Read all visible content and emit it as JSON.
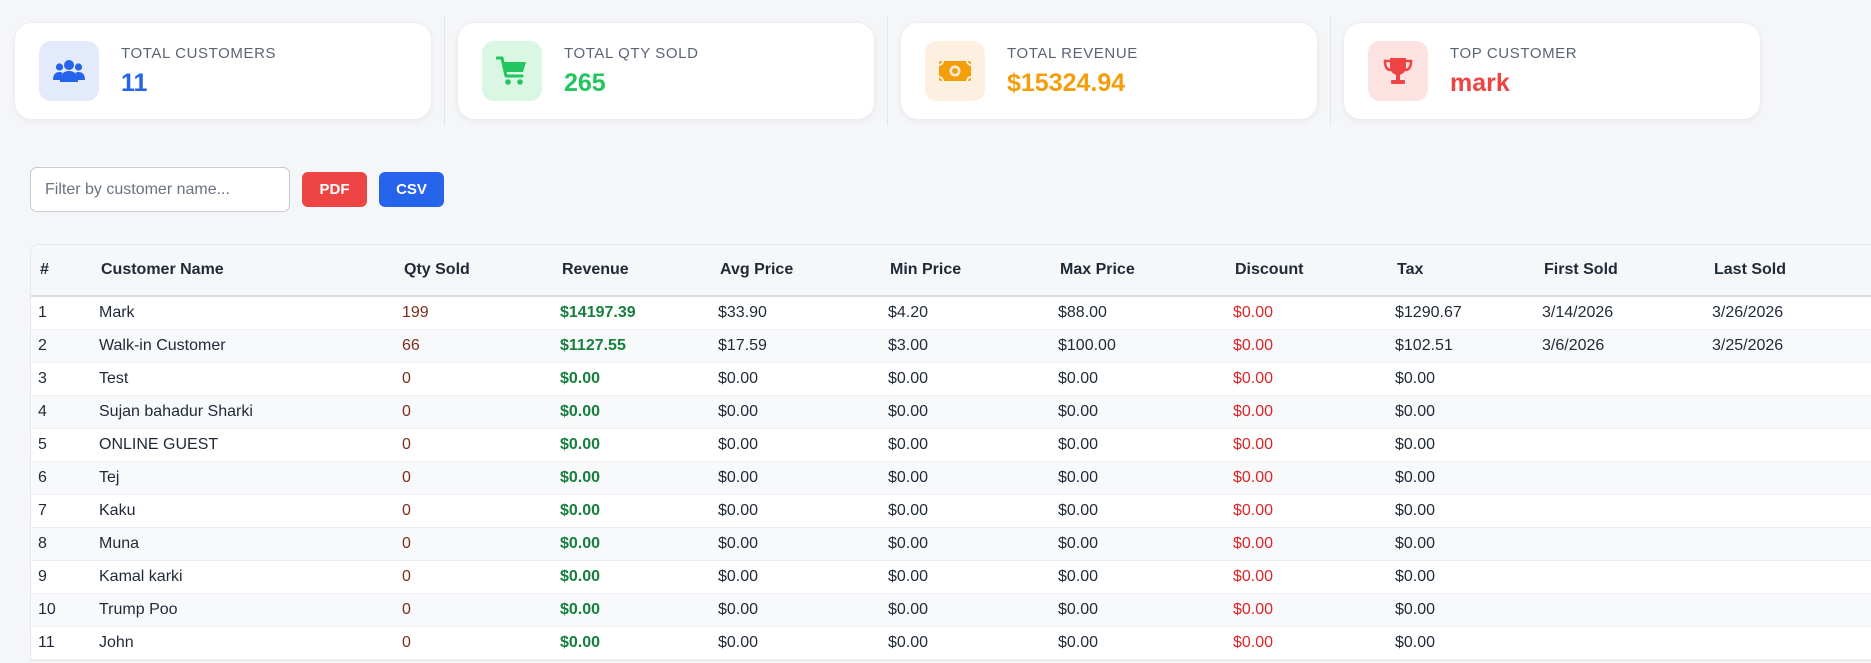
{
  "colors": {
    "blue": "#2563eb",
    "green": "#22c55e",
    "orange": "#f59e0b",
    "red": "#ef4444"
  },
  "cards": [
    {
      "label": "TOTAL CUSTOMERS",
      "value": "11",
      "icon": "users-icon"
    },
    {
      "label": "TOTAL QTY SOLD",
      "value": "265",
      "icon": "shopping-cart-icon"
    },
    {
      "label": "TOTAL REVENUE",
      "value": "$15324.94",
      "icon": "money-bill-icon"
    },
    {
      "label": "TOP CUSTOMER",
      "value": "mark",
      "icon": "trophy-icon"
    }
  ],
  "toolbar": {
    "filter_placeholder": "Filter by customer name...",
    "pdf_label": "PDF",
    "csv_label": "CSV"
  },
  "table": {
    "columns": [
      "#",
      "Customer Name",
      "Qty Sold",
      "Revenue",
      "Avg Price",
      "Min Price",
      "Max Price",
      "Discount",
      "Tax",
      "First Sold",
      "Last Sold"
    ],
    "rows": [
      [
        "1",
        "Mark",
        "199",
        "$14197.39",
        "$33.90",
        "$4.20",
        "$88.00",
        "$0.00",
        "$1290.67",
        "3/14/2026",
        "3/26/2026"
      ],
      [
        "2",
        "Walk-in Customer",
        "66",
        "$1127.55",
        "$17.59",
        "$3.00",
        "$100.00",
        "$0.00",
        "$102.51",
        "3/6/2026",
        "3/25/2026"
      ],
      [
        "3",
        "Test",
        "0",
        "$0.00",
        "$0.00",
        "$0.00",
        "$0.00",
        "$0.00",
        "$0.00",
        "",
        ""
      ],
      [
        "4",
        "Sujan bahadur Sharki",
        "0",
        "$0.00",
        "$0.00",
        "$0.00",
        "$0.00",
        "$0.00",
        "$0.00",
        "",
        ""
      ],
      [
        "5",
        "ONLINE GUEST",
        "0",
        "$0.00",
        "$0.00",
        "$0.00",
        "$0.00",
        "$0.00",
        "$0.00",
        "",
        ""
      ],
      [
        "6",
        "Tej",
        "0",
        "$0.00",
        "$0.00",
        "$0.00",
        "$0.00",
        "$0.00",
        "$0.00",
        "",
        ""
      ],
      [
        "7",
        "Kaku",
        "0",
        "$0.00",
        "$0.00",
        "$0.00",
        "$0.00",
        "$0.00",
        "$0.00",
        "",
        ""
      ],
      [
        "8",
        "Muna",
        "0",
        "$0.00",
        "$0.00",
        "$0.00",
        "$0.00",
        "$0.00",
        "$0.00",
        "",
        ""
      ],
      [
        "9",
        "Kamal karki",
        "0",
        "$0.00",
        "$0.00",
        "$0.00",
        "$0.00",
        "$0.00",
        "$0.00",
        "",
        ""
      ],
      [
        "10",
        "Trump Poo",
        "0",
        "$0.00",
        "$0.00",
        "$0.00",
        "$0.00",
        "$0.00",
        "$0.00",
        "",
        ""
      ],
      [
        "11",
        "John",
        "0",
        "$0.00",
        "$0.00",
        "$0.00",
        "$0.00",
        "$0.00",
        "$0.00",
        "",
        ""
      ]
    ]
  }
}
